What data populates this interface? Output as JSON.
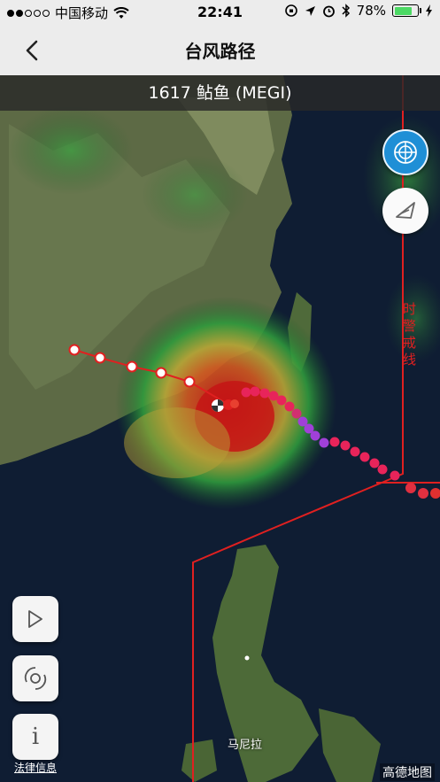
{
  "status_bar": {
    "carrier": "中国移动",
    "time": "22:41",
    "battery": "78%"
  },
  "nav": {
    "title": "台风路径"
  },
  "storm": {
    "title": "1617 鲇鱼 (MEGI)"
  },
  "map": {
    "warning_line_label": "时警戒线",
    "city_label": "马尼拉"
  },
  "controls": {
    "info_label": "i",
    "legal_link": "法律信息"
  },
  "logo": {
    "text": "高德地图"
  },
  "colors": {
    "radar_button": "#1f8fd6",
    "warning_line": "#e02020",
    "forecast_points": "#e8245a",
    "track_points_past": "#ffffff",
    "forecast_purple": "#a040d8"
  }
}
